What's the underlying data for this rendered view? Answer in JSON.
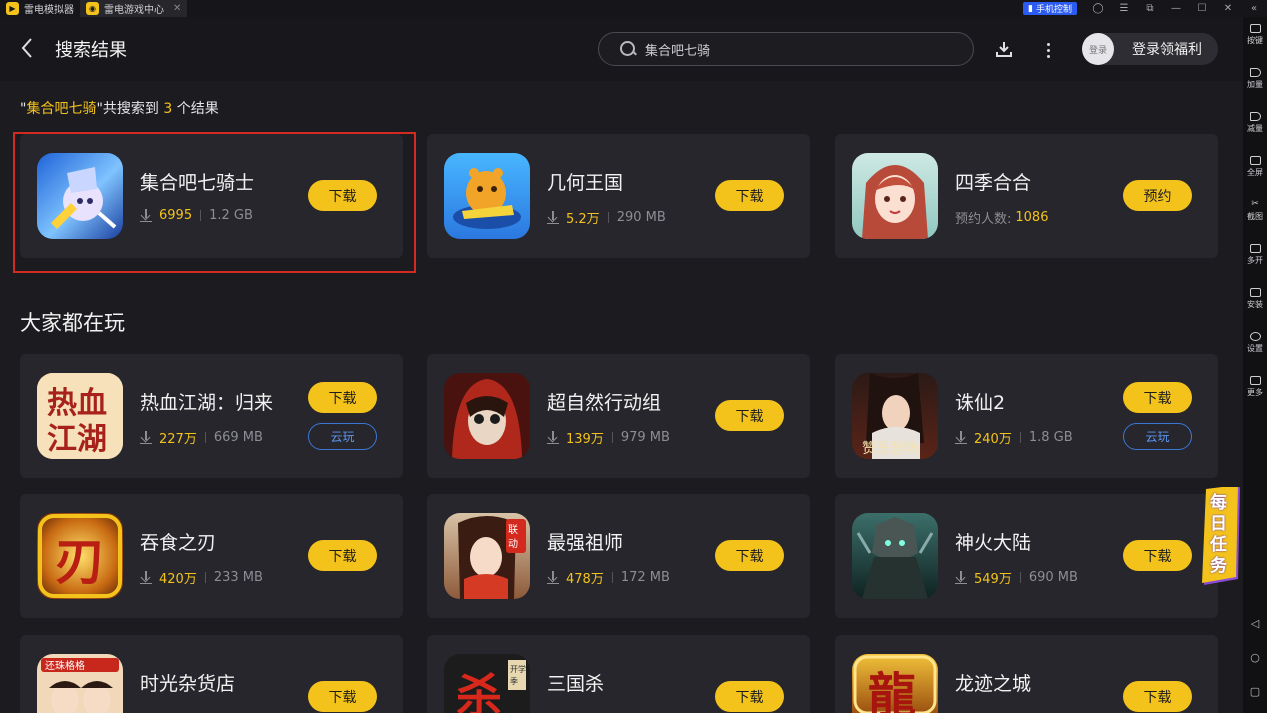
{
  "titlebar": {
    "tabs": [
      {
        "label": "雷电模拟器"
      },
      {
        "label": "雷电游戏中心"
      }
    ],
    "phone_control": "手机控制"
  },
  "header": {
    "title": "搜索结果",
    "search_value": "集合吧七骑",
    "login_avatar": "登录",
    "login_label": "登录领福利"
  },
  "result_summary": {
    "quote_open": "\"",
    "keyword": "集合吧七骑",
    "mid": "\"共搜索到 ",
    "count": "3",
    "tail": " 个结果"
  },
  "search_results": [
    {
      "name": "集合吧七骑士",
      "count": "6995",
      "size": "1.2 GB",
      "button": "下载"
    },
    {
      "name": "几何王国",
      "count": "5.2万",
      "size": "290 MB",
      "button": "下载"
    },
    {
      "name": "四季合合",
      "count_label": "预约人数:",
      "count": "1086",
      "button": "预约"
    }
  ],
  "section_title": "大家都在玩",
  "popular": [
    {
      "name": "热血江湖：归来",
      "count": "227万",
      "size": "669 MB",
      "button": "下载",
      "cloud": "云玩"
    },
    {
      "name": "超自然行动组",
      "count": "139万",
      "size": "979 MB",
      "button": "下载"
    },
    {
      "name": "诛仙2",
      "count": "240万",
      "size": "1.8 GB",
      "button": "下载",
      "cloud": "云玩"
    },
    {
      "name": "吞食之刃",
      "count": "420万",
      "size": "233 MB",
      "button": "下载"
    },
    {
      "name": "最强祖师",
      "count": "478万",
      "size": "172 MB",
      "button": "下载"
    },
    {
      "name": "神火大陆",
      "count": "549万",
      "size": "690 MB",
      "button": "下载"
    },
    {
      "name": "时光杂货店",
      "button": "下载"
    },
    {
      "name": "三国杀",
      "button": "下载"
    },
    {
      "name": "龙迹之城",
      "button": "下载"
    }
  ],
  "sidebar": [
    {
      "label": "按键"
    },
    {
      "label": "加量"
    },
    {
      "label": "减量"
    },
    {
      "label": "全屏"
    },
    {
      "label": "截图"
    },
    {
      "label": "多开"
    },
    {
      "label": "安装"
    },
    {
      "label": "设置"
    },
    {
      "label": "更多"
    }
  ],
  "daily_task": "每日任务",
  "colors": {
    "accent": "#f4c31b",
    "cloud": "#3b78d6",
    "selection": "#d22b22"
  }
}
